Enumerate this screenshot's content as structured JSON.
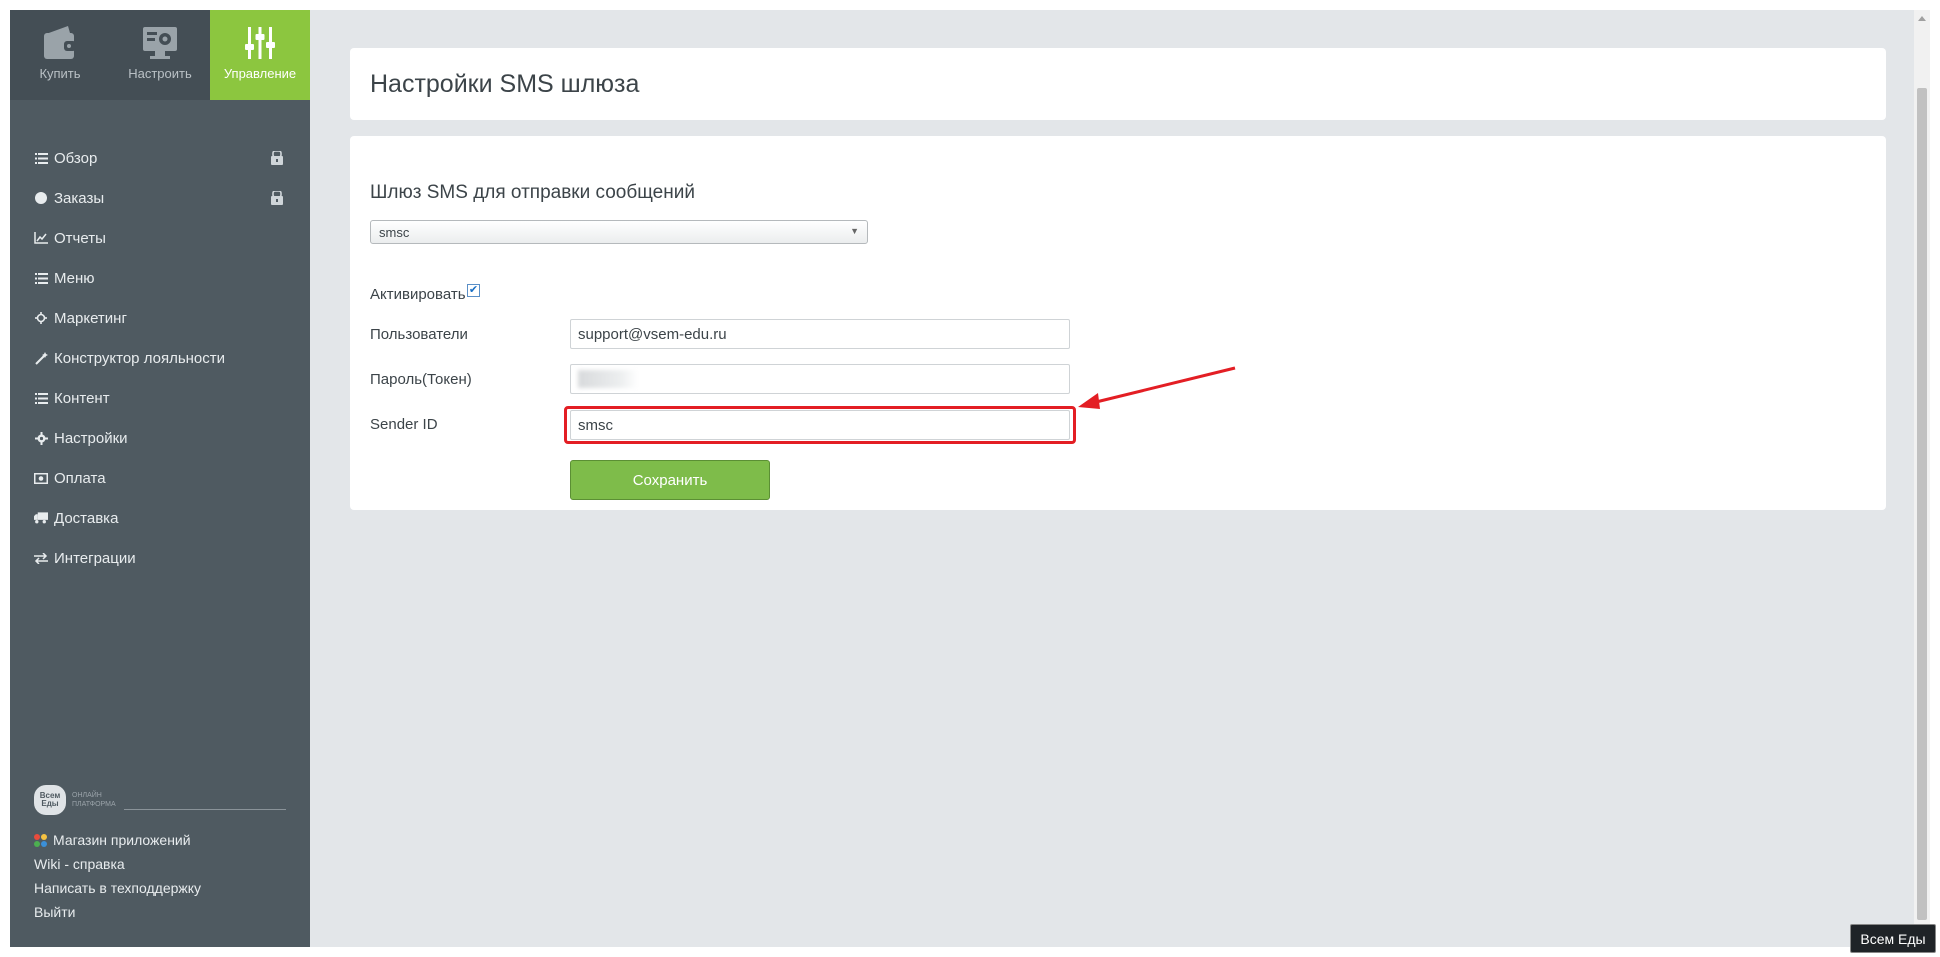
{
  "topnav": {
    "buy_label": "Купить",
    "setup_label": "Настроить",
    "manage_label": "Управление"
  },
  "sidebar": {
    "items": [
      {
        "label": "Обзор",
        "icon": "list-icon",
        "locked": true
      },
      {
        "label": "Заказы",
        "icon": "circle-icon",
        "locked": true
      },
      {
        "label": "Отчеты",
        "icon": "line-chart-icon"
      },
      {
        "label": "Меню",
        "icon": "list-icon"
      },
      {
        "label": "Маркетинг",
        "icon": "crosshair-icon"
      },
      {
        "label": "Конструктор лояльности",
        "icon": "magic-wand-icon"
      },
      {
        "label": "Контент",
        "icon": "list-icon"
      },
      {
        "label": "Настройки",
        "icon": "gear-icon"
      },
      {
        "label": "Оплата",
        "icon": "money-icon"
      },
      {
        "label": "Доставка",
        "icon": "truck-icon"
      },
      {
        "label": "Интеграции",
        "icon": "exchange-icon"
      }
    ],
    "footer": {
      "logo_text": "Всем Еды",
      "logo_subtext_1": "ОНЛАЙН",
      "logo_subtext_2": "ПЛАТФОРМА",
      "app_store": "Магазин приложений",
      "wiki": "Wiki - справка",
      "support": "Написать в техподдержку",
      "logout": "Выйти"
    }
  },
  "page": {
    "title": "Настройки SMS шлюза"
  },
  "form": {
    "gateway_label": "Шлюз SMS для отправки сообщений",
    "gateway_value": "smsc",
    "activate_label": "Активировать",
    "activate_checked": true,
    "users_label": "Пользователи",
    "users_value": "support@vsem-edu.ru",
    "password_label": "Пароль(Токен)",
    "sender_label": "Sender ID",
    "sender_value": "smsc",
    "save_label": "Сохранить"
  },
  "badge": {
    "label": "Всем Еды"
  },
  "colors": {
    "accent": "#8cc63f",
    "sidebar": "#4f5a61",
    "highlight": "#e31e24",
    "button": "#7ebc4a"
  }
}
